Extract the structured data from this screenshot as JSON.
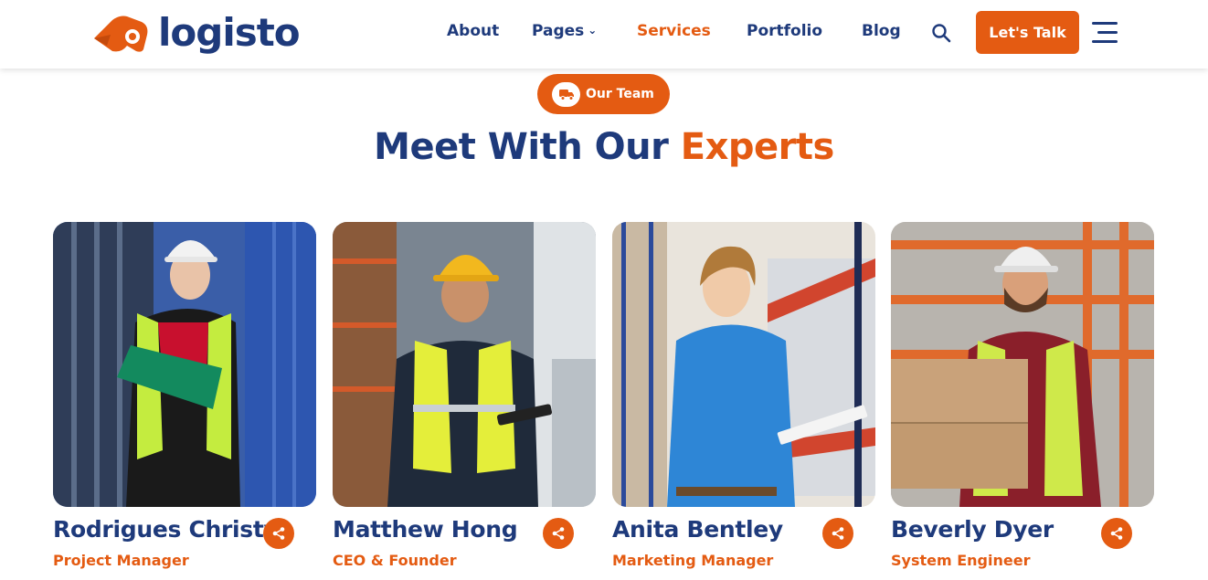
{
  "brand": {
    "name": "logisto",
    "primary": "#1e3a7b",
    "accent": "#e45b12"
  },
  "nav": {
    "about": "About",
    "pages": "Pages",
    "services": "Services",
    "portfolio": "Portfolio",
    "blog": "Blog",
    "active": "Services"
  },
  "header": {
    "cta_label": "Let's Talk",
    "search_icon": "search-icon",
    "menu_icon": "hamburger-menu-icon"
  },
  "section": {
    "badge": "Our Team",
    "title_main": "Meet With Our",
    "title_accent": "Experts"
  },
  "team": [
    {
      "name": "Rodrigues Christy",
      "role": "Project Manager"
    },
    {
      "name": "Matthew Hong",
      "role": "CEO & Founder"
    },
    {
      "name": "Anita Bentley",
      "role": "Marketing Manager"
    },
    {
      "name": "Beverly Dyer",
      "role": "System Engineer"
    }
  ]
}
